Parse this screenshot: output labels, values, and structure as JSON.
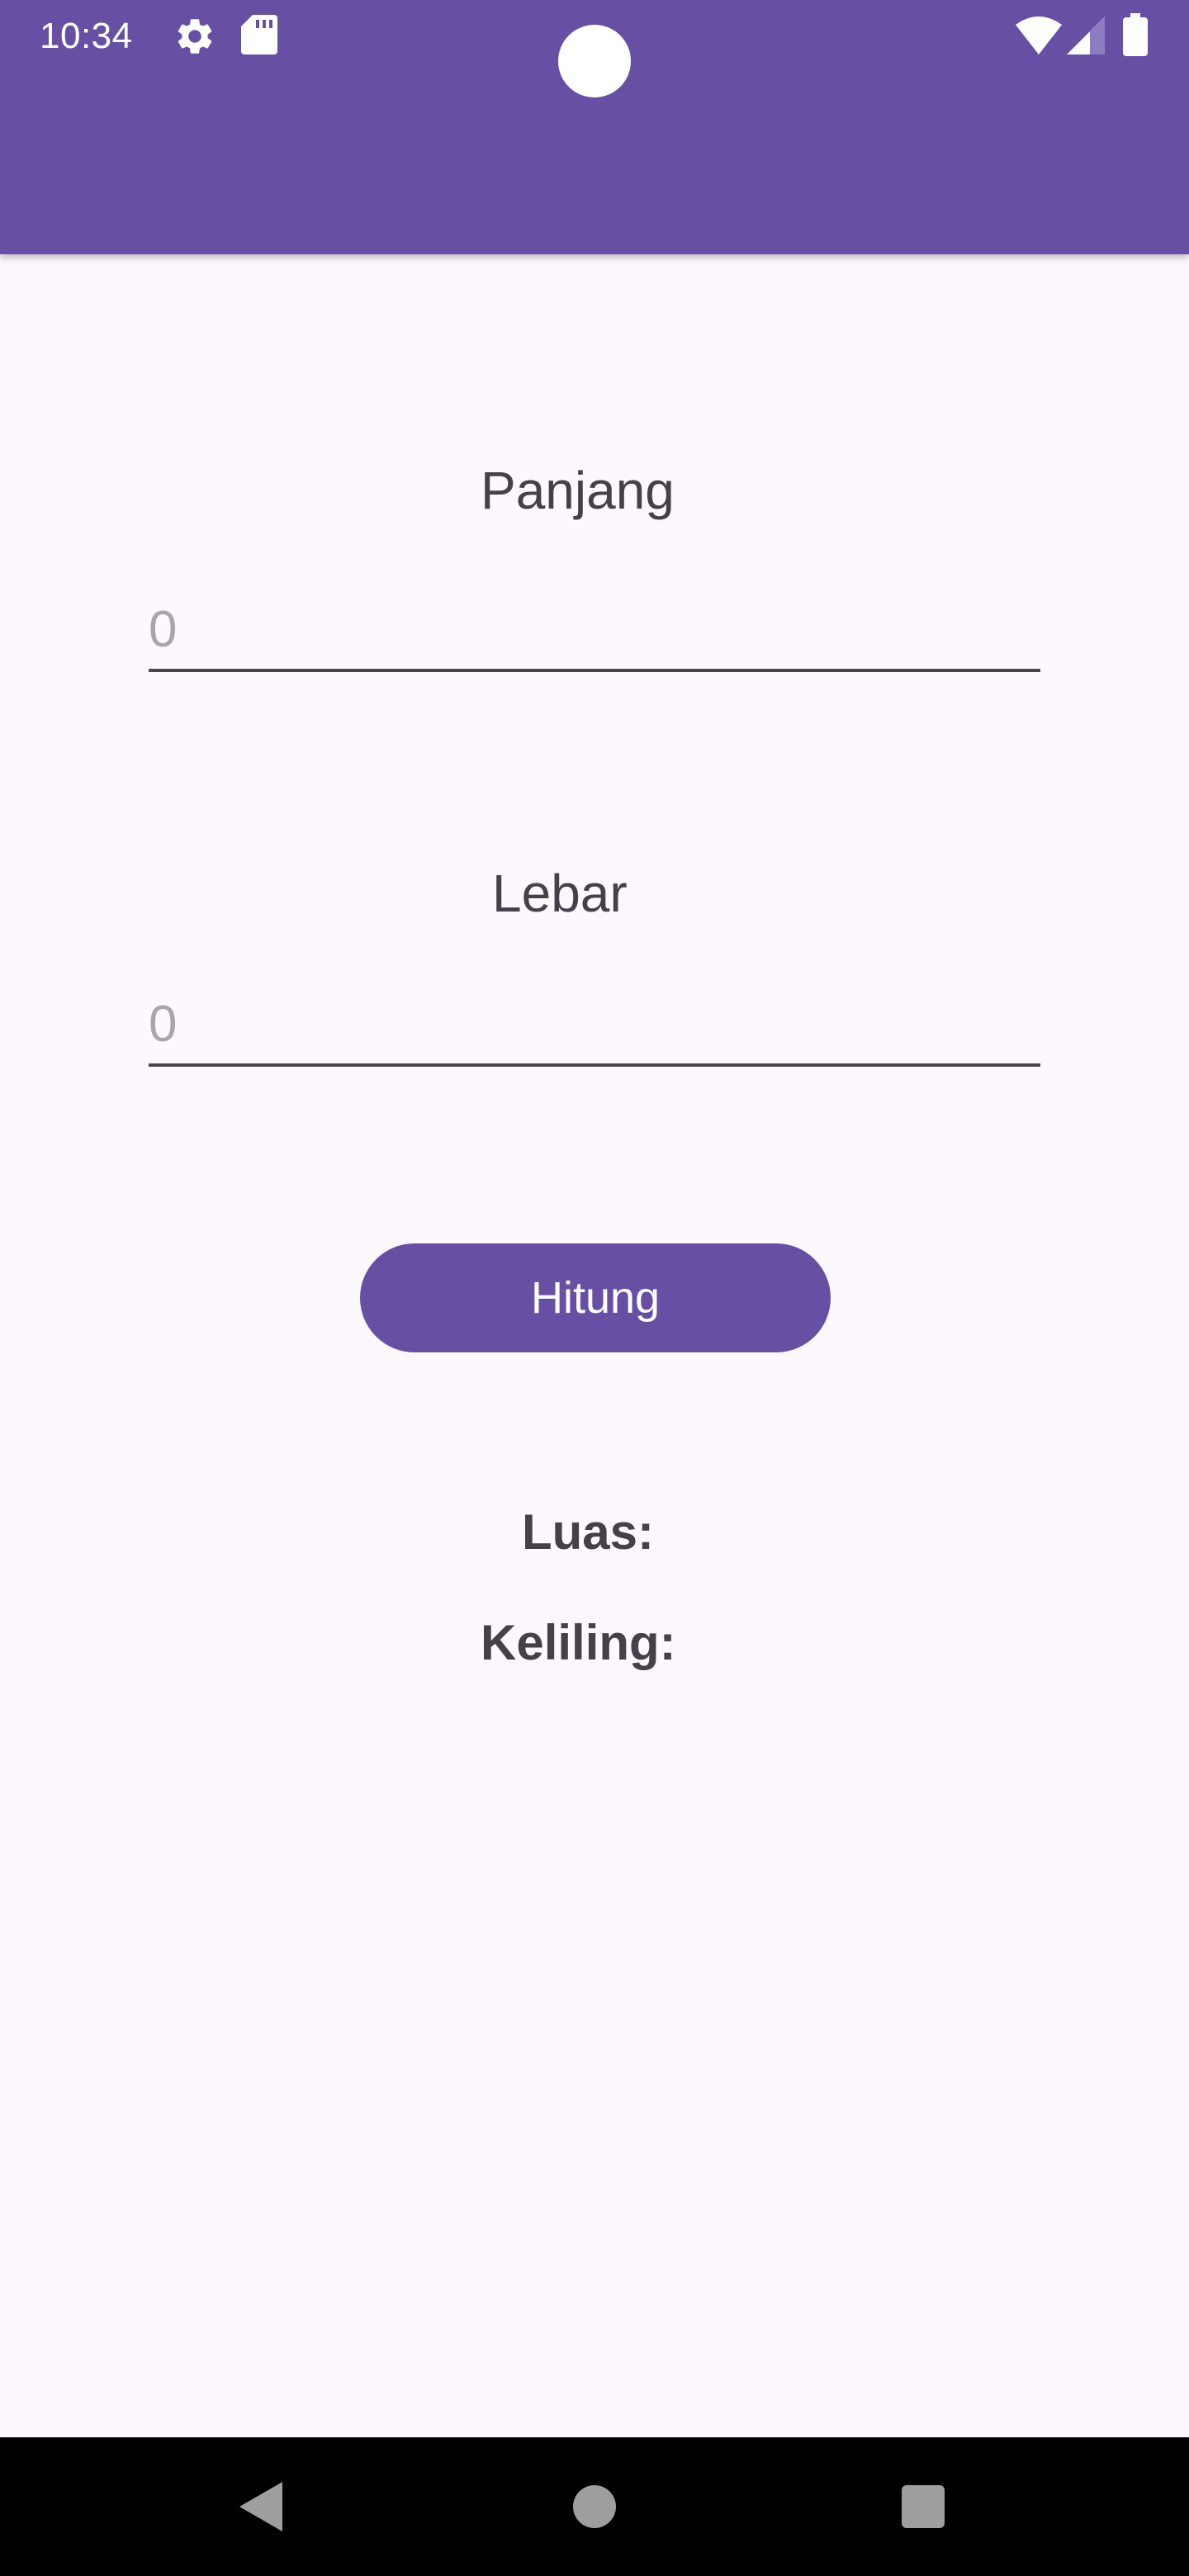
{
  "status_bar": {
    "time": "10:34",
    "icons": [
      "gear-icon",
      "sd-card-icon",
      "wifi-icon",
      "cellular-signal-icon",
      "battery-icon"
    ]
  },
  "form": {
    "panjang_label": "Panjang",
    "panjang_placeholder": "0",
    "lebar_label": "Lebar",
    "lebar_placeholder": "0",
    "button_label": "Hitung"
  },
  "results": {
    "luas_label": "Luas:",
    "keliling_label": "Keliling:"
  },
  "nav": {
    "icons": [
      "back-icon",
      "home-icon",
      "recents-icon"
    ]
  },
  "colors": {
    "primary": "#6750A4",
    "background": "#FDF8FD",
    "text": "#45414A",
    "placeholder": "#A8A6AB"
  }
}
